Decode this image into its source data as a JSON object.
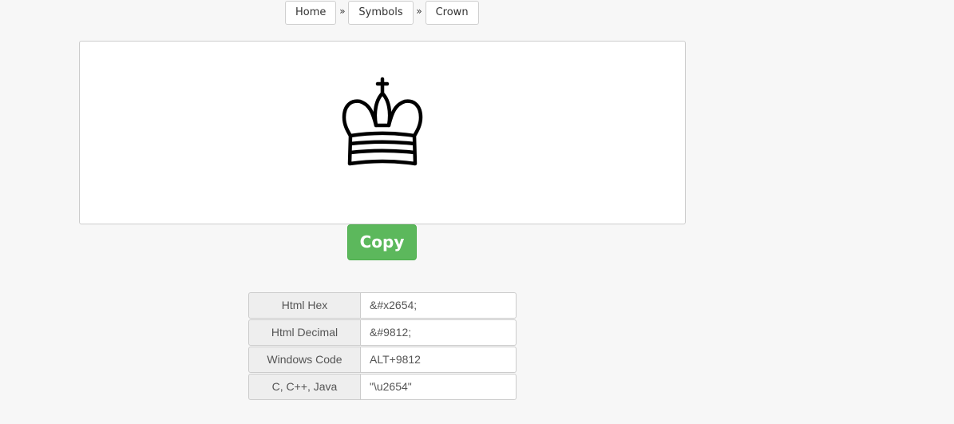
{
  "breadcrumb": {
    "items": [
      "Home",
      "Symbols",
      "Crown"
    ],
    "separator": "»"
  },
  "symbol": {
    "icon": "chess-king-icon",
    "char": "♔"
  },
  "copy_button": {
    "label": "Copy",
    "color": "#5cb85c"
  },
  "codes": [
    {
      "label": "Html Hex",
      "value": "&#x2654;"
    },
    {
      "label": "Html Decimal",
      "value": "&#9812;"
    },
    {
      "label": "Windows Code",
      "value": "ALT+9812"
    },
    {
      "label": "C, C++, Java",
      "value": "\"\\u2654\""
    }
  ]
}
